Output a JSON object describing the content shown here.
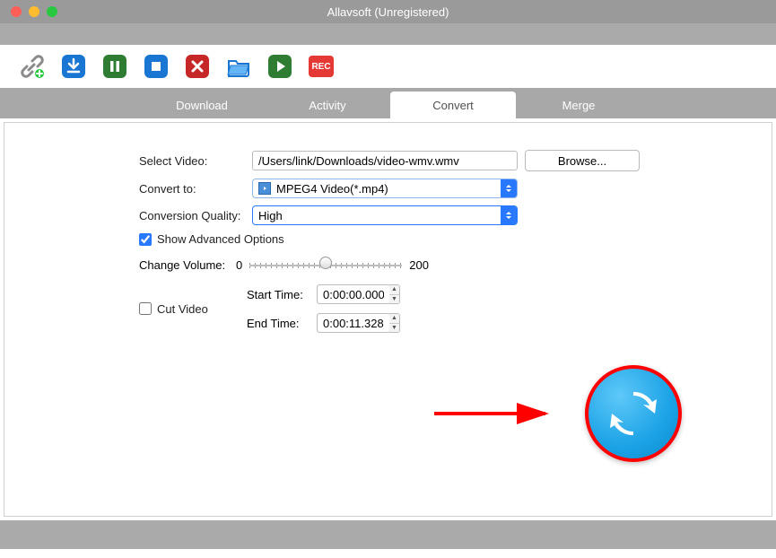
{
  "window": {
    "title": "Allavsoft (Unregistered)"
  },
  "toolbar": {
    "rec_label": "REC"
  },
  "tabs": {
    "download": "Download",
    "activity": "Activity",
    "convert": "Convert",
    "merge": "Merge"
  },
  "form": {
    "select_video_label": "Select Video:",
    "select_video_value": "/Users/link/Downloads/video-wmv.wmv",
    "browse_label": "Browse...",
    "convert_to_label": "Convert to:",
    "convert_to_value": "MPEG4 Video(*.mp4)",
    "quality_label": "Conversion Quality:",
    "quality_value": "High",
    "show_advanced_label": "Show Advanced Options",
    "volume_label": "Change Volume:",
    "volume_min": "0",
    "volume_max": "200",
    "cut_video_label": "Cut Video",
    "start_time_label": "Start Time:",
    "start_time_value": "0:00:00.000",
    "end_time_label": "End Time:",
    "end_time_value": "0:00:11.328"
  }
}
